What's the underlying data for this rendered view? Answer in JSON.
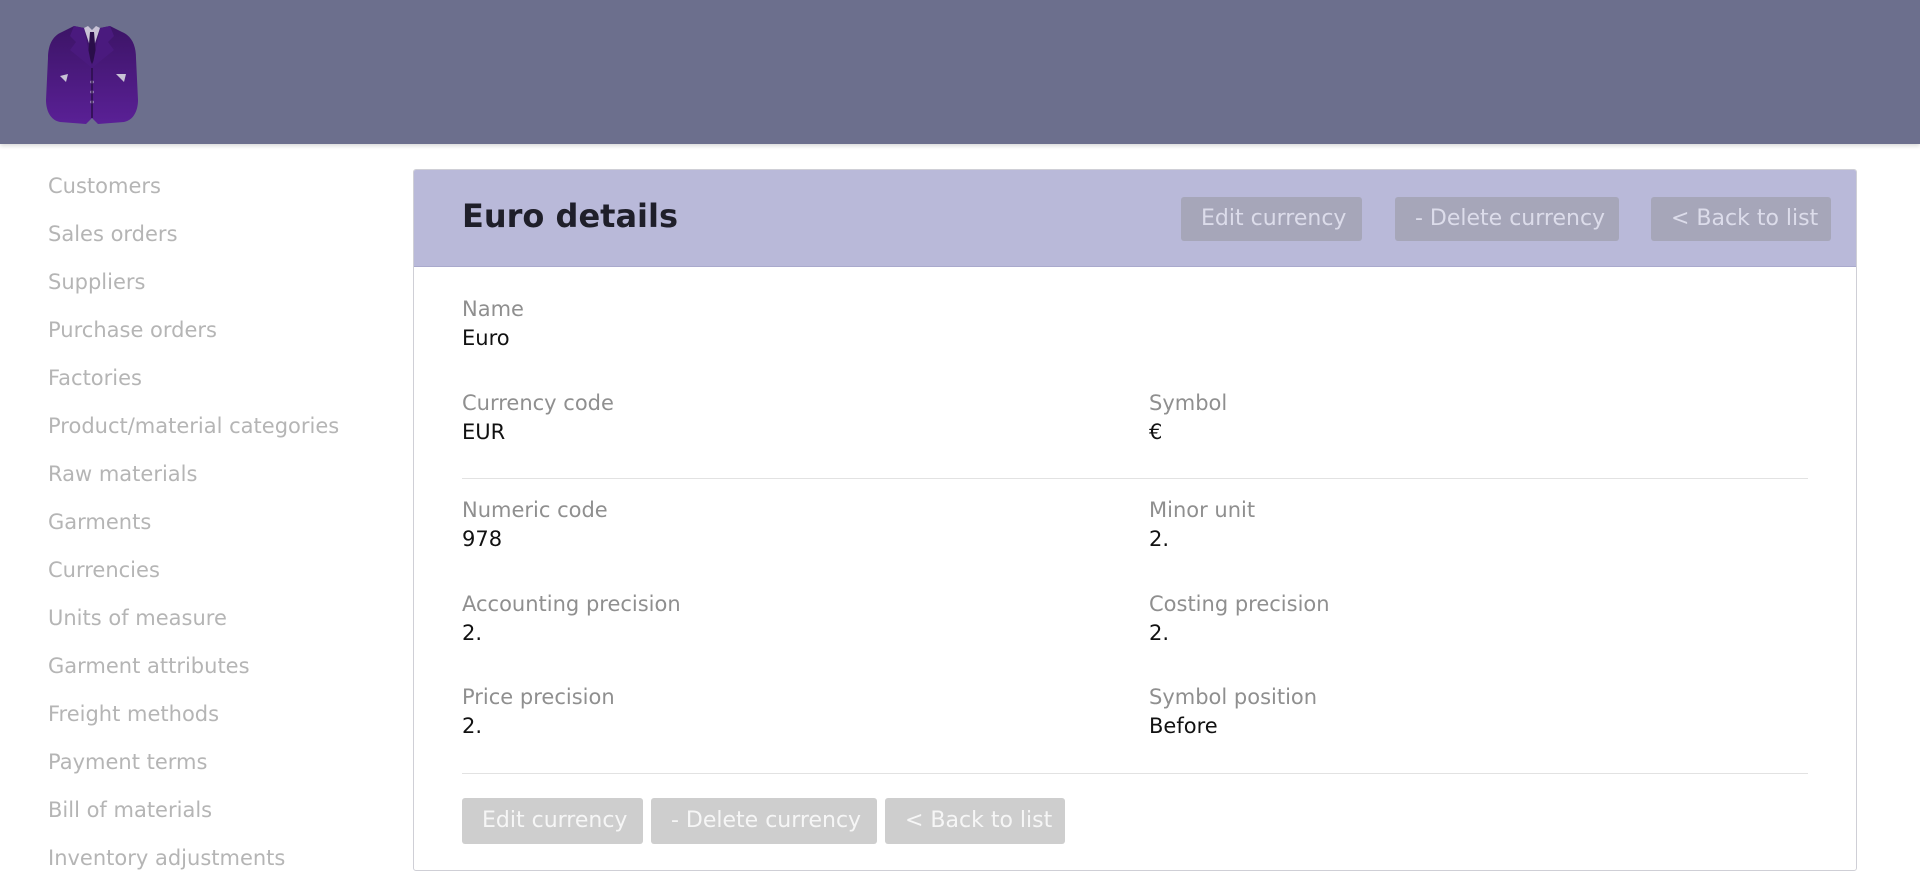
{
  "brand": {
    "logo_icon": "jacket-logo-icon"
  },
  "sidebar": {
    "items": [
      {
        "label": "Customers"
      },
      {
        "label": "Sales orders"
      },
      {
        "label": "Suppliers"
      },
      {
        "label": "Purchase orders"
      },
      {
        "label": "Factories"
      },
      {
        "label": "Product/material categories"
      },
      {
        "label": "Raw materials"
      },
      {
        "label": "Garments"
      },
      {
        "label": "Currencies"
      },
      {
        "label": "Units of measure"
      },
      {
        "label": "Garment attributes"
      },
      {
        "label": "Freight methods"
      },
      {
        "label": "Payment terms"
      },
      {
        "label": "Bill of materials"
      },
      {
        "label": "Inventory adjustments"
      }
    ]
  },
  "panel": {
    "title": "Euro details",
    "header_buttons": {
      "edit": "Edit currency",
      "delete": "- Delete currency",
      "back": "< Back to list"
    },
    "fields": {
      "name": {
        "label": "Name",
        "value": "Euro"
      },
      "currency_code": {
        "label": "Currency code",
        "value": "EUR"
      },
      "symbol": {
        "label": "Symbol",
        "value": "€"
      },
      "numeric_code": {
        "label": "Numeric code",
        "value": "978"
      },
      "minor_unit": {
        "label": "Minor unit",
        "value": "2."
      },
      "accounting_precision": {
        "label": "Accounting precision",
        "value": "2."
      },
      "costing_precision": {
        "label": "Costing precision",
        "value": "2."
      },
      "price_precision": {
        "label": "Price precision",
        "value": "2."
      },
      "symbol_position": {
        "label": "Symbol position",
        "value": "Before"
      }
    },
    "footer_buttons": {
      "edit": "Edit currency",
      "delete": "- Delete currency",
      "back": "< Back to list"
    }
  },
  "colors": {
    "topbar": "#6c6f8d",
    "panel_header": "#b9b9d9",
    "logo": "#4b1a7a"
  }
}
